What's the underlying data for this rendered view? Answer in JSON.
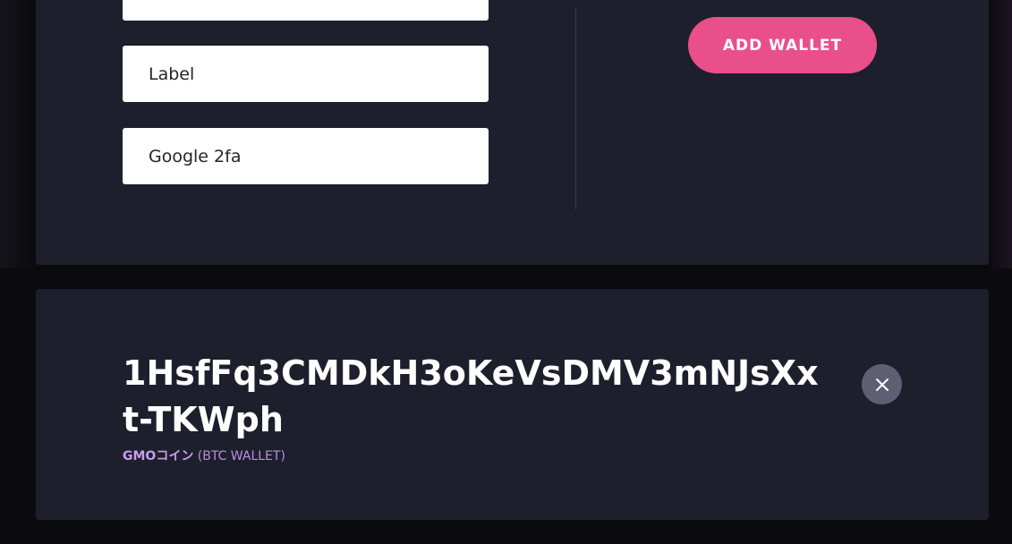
{
  "form": {
    "label_placeholder": "Label",
    "twofa_placeholder": "Google 2fa",
    "add_wallet_label": "ADD WALLET"
  },
  "wallet": {
    "address": "1HsfFq3CMDkH3oKeVsDMV3mNJsXxt-TKWph",
    "exchange": "GMOコイン",
    "type": "(BTC WALLET)"
  },
  "icons": {
    "remove": "close-icon"
  },
  "colors": {
    "accent": "#e9508b",
    "panel": "#1e1f2c",
    "background": "#0b0a0d",
    "wallet_meta": "#b98ee0"
  }
}
